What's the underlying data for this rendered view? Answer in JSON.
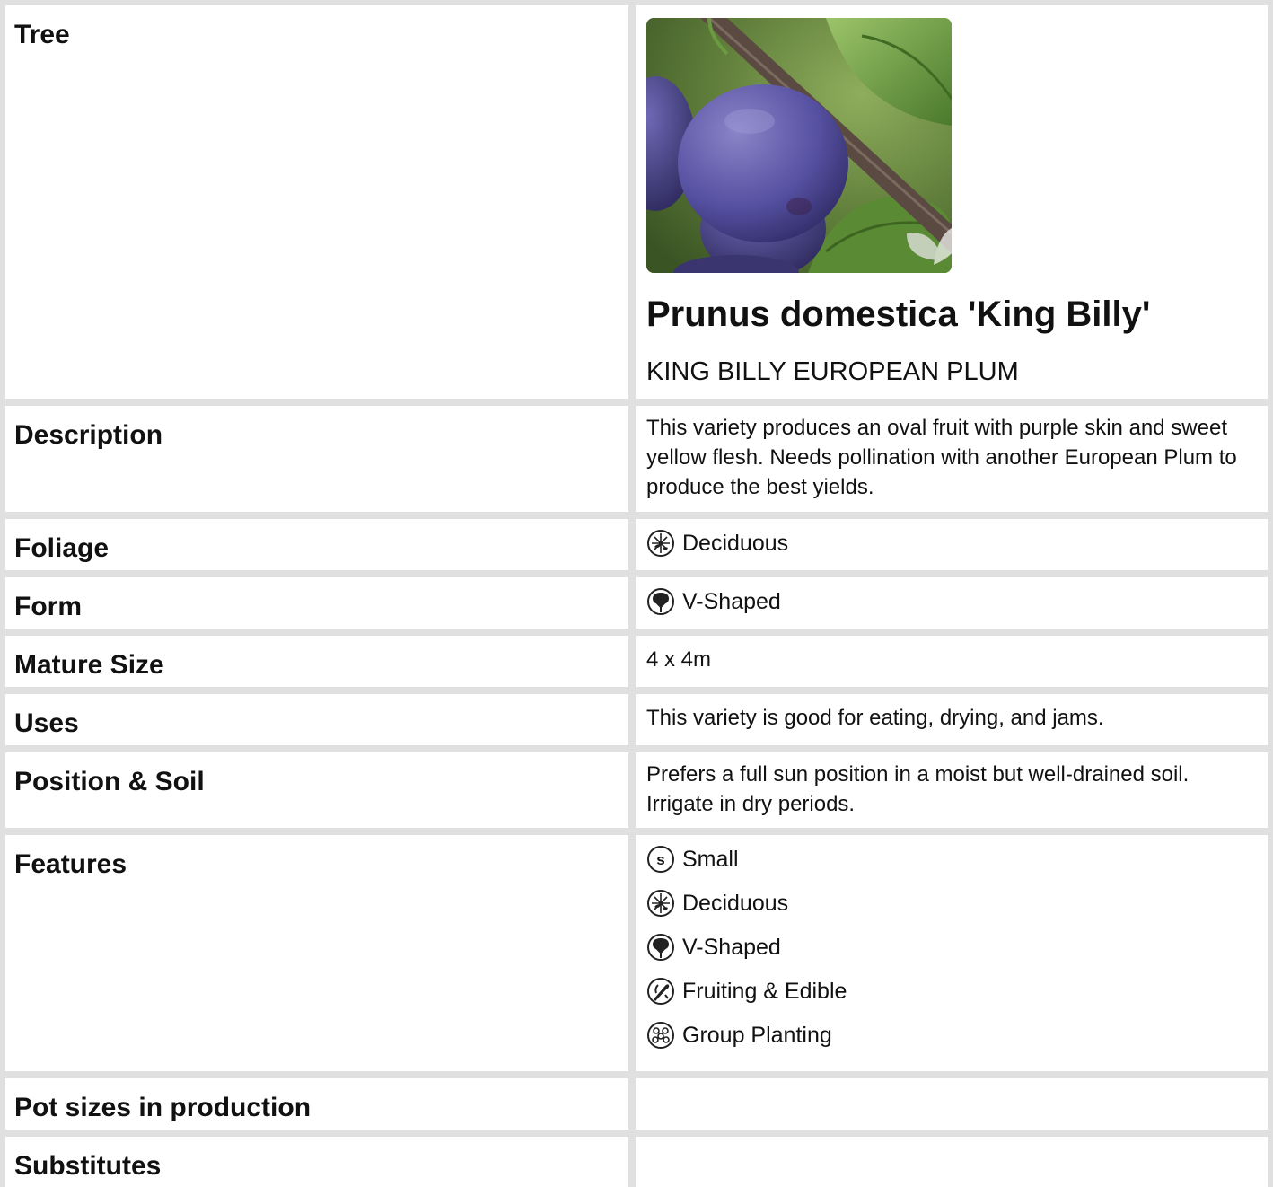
{
  "header": {
    "category": "Tree",
    "botanical_name": "Prunus domestica 'King Billy'",
    "common_name": "KING BILLY EUROPEAN PLUM",
    "photo_icon": "leaf-watermark-icon"
  },
  "rows": {
    "description": {
      "label": "Description",
      "value": "This variety produces an oval fruit with purple skin and sweet yellow flesh. Needs pollination with another European Plum to produce the best yields."
    },
    "foliage": {
      "label": "Foliage",
      "icon": "deciduous-icon",
      "value": "Deciduous"
    },
    "form": {
      "label": "Form",
      "icon": "v-shaped-icon",
      "value": "V-Shaped"
    },
    "mature_size": {
      "label": "Mature Size",
      "value": "4 x 4m"
    },
    "uses": {
      "label": "Uses",
      "value": "This variety is good for eating, drying, and jams."
    },
    "position_soil": {
      "label": "Position & Soil",
      "value": "Prefers a full sun position in a moist but well-drained soil. Irrigate in dry periods."
    },
    "features": {
      "label": "Features",
      "items": [
        {
          "icon": "small-icon",
          "text": "Small"
        },
        {
          "icon": "deciduous-icon",
          "text": "Deciduous"
        },
        {
          "icon": "v-shaped-icon",
          "text": "V-Shaped"
        },
        {
          "icon": "fruiting-edible-icon",
          "text": "Fruiting & Edible"
        },
        {
          "icon": "group-planting-icon",
          "text": "Group Planting"
        }
      ]
    },
    "pot_sizes": {
      "label": "Pot sizes in production",
      "value": ""
    },
    "substitutes": {
      "label": "Substitutes",
      "value": ""
    }
  }
}
